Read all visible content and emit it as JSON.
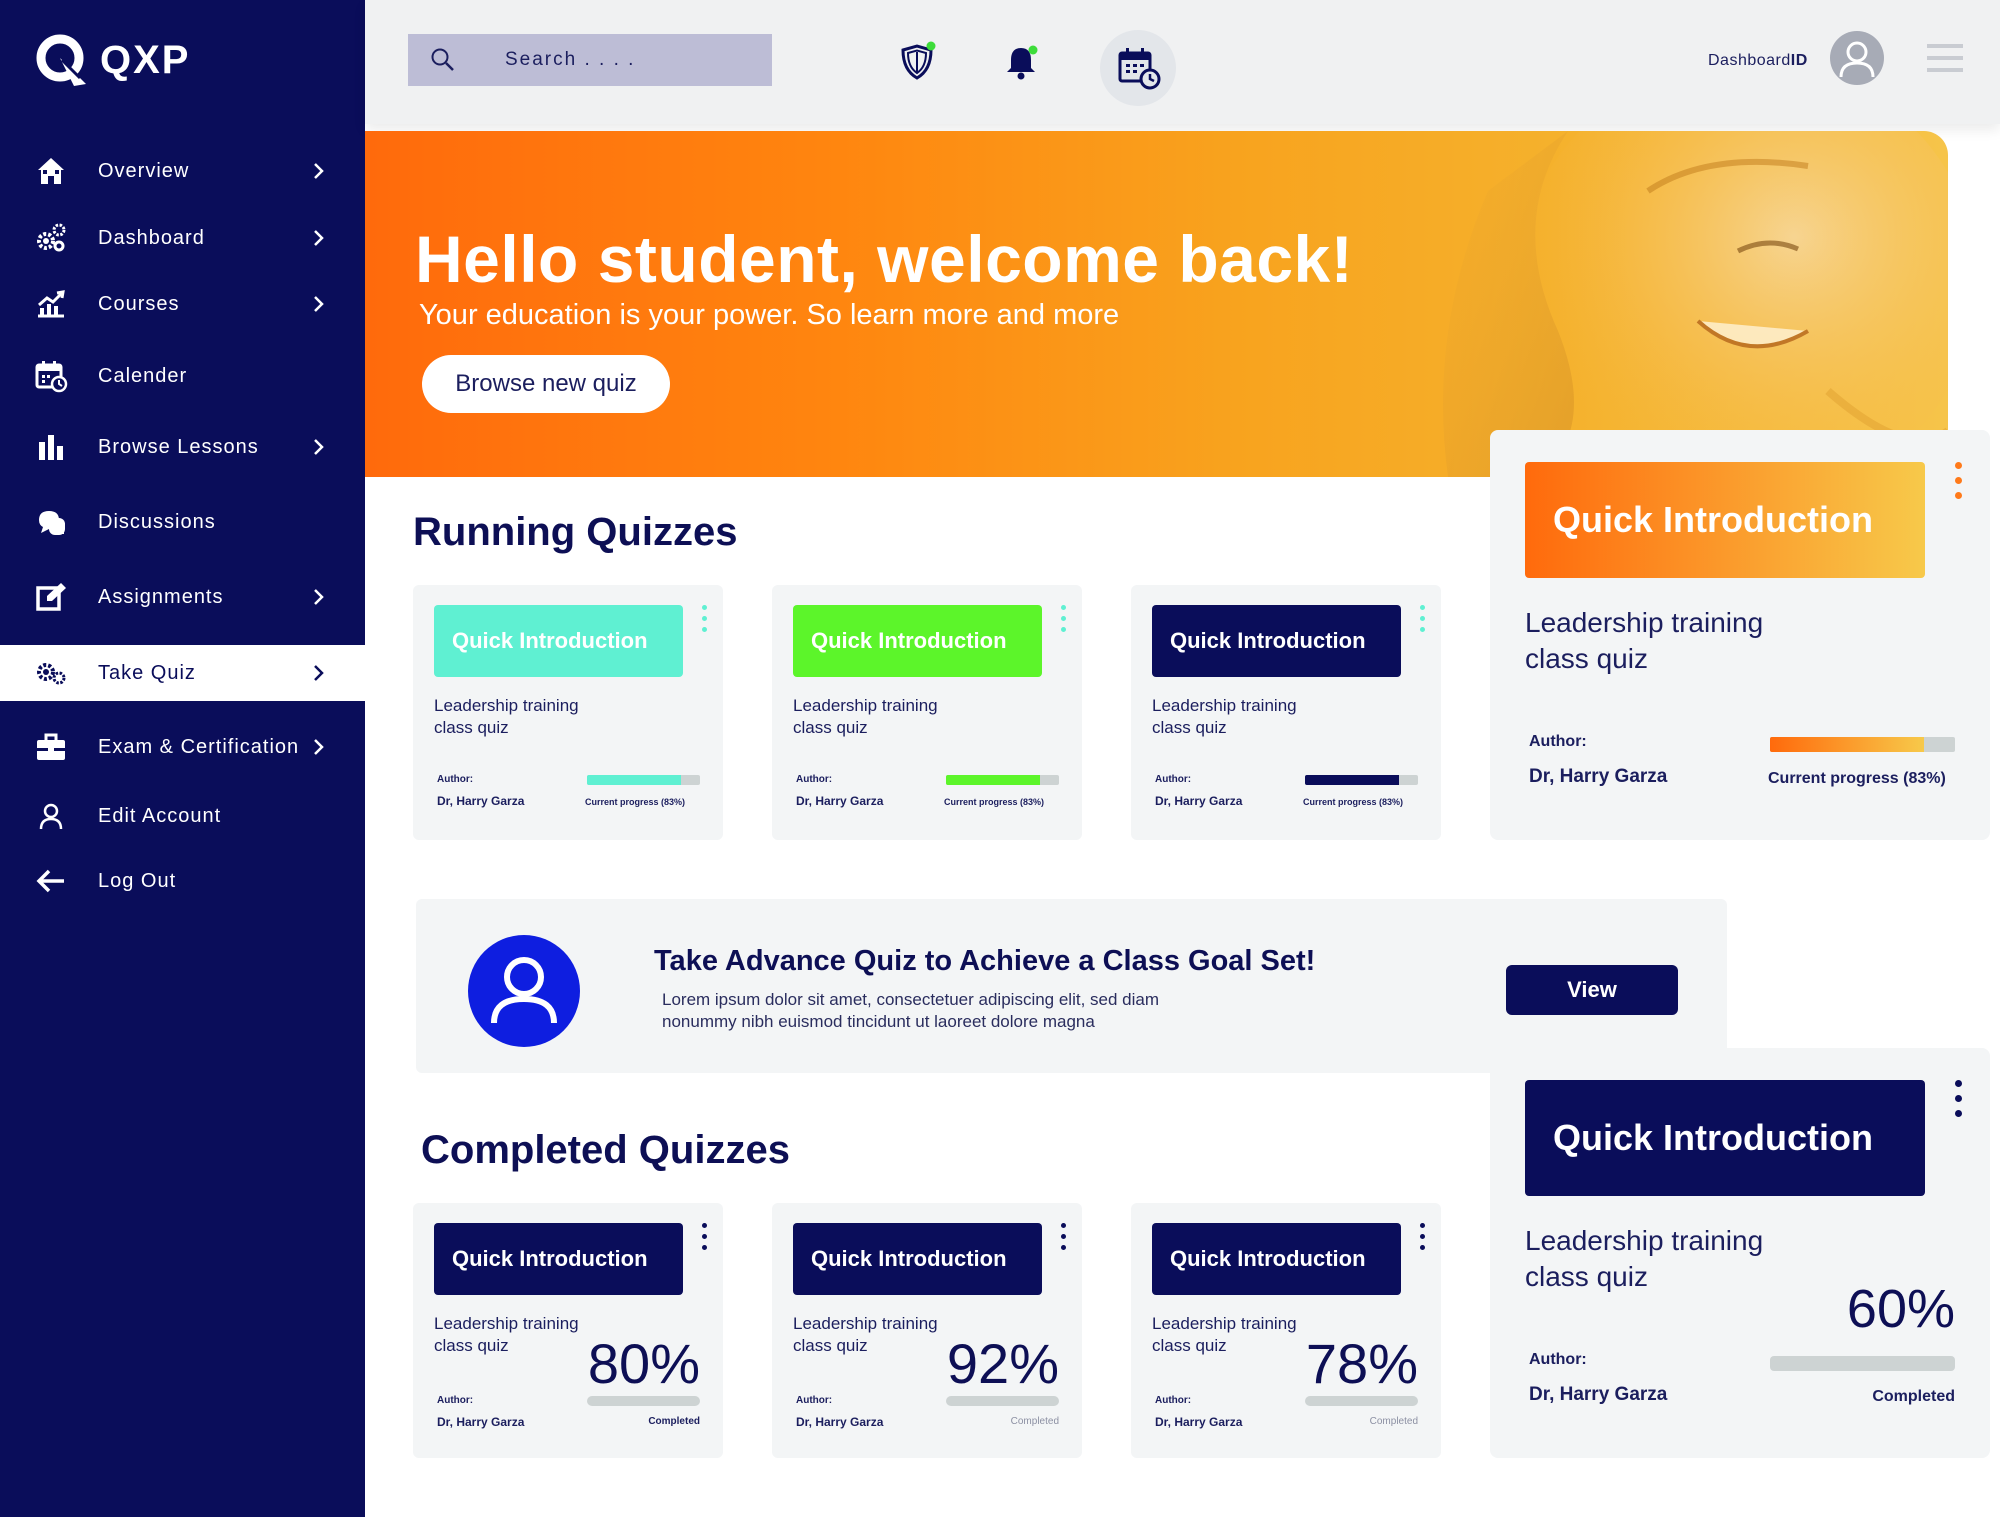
{
  "brand": {
    "name": "QXP"
  },
  "sidebar": {
    "items": [
      {
        "label": "Overview",
        "icon": "home-icon",
        "chevron": true
      },
      {
        "label": "Dashboard",
        "icon": "gears-icon",
        "chevron": true
      },
      {
        "label": "Courses",
        "icon": "chart-icon",
        "chevron": true
      },
      {
        "label": "Calender",
        "icon": "calendar-icon",
        "chevron": false
      },
      {
        "label": "Browse Lessons",
        "icon": "bar-chart-icon",
        "chevron": true
      },
      {
        "label": "Discussions",
        "icon": "chat-icon",
        "chevron": false
      },
      {
        "label": "Assignments",
        "icon": "edit-icon",
        "chevron": true
      },
      {
        "label": "Take Quiz",
        "icon": "gears-icon",
        "chevron": true,
        "active": true
      },
      {
        "label": "Exam & Certification",
        "icon": "briefcase-icon",
        "chevron": true
      },
      {
        "label": "Edit Account",
        "icon": "user-icon",
        "chevron": false
      },
      {
        "label": "Log Out",
        "icon": "arrow-left-icon",
        "chevron": false
      }
    ]
  },
  "topbar": {
    "search_placeholder": "Search . . . .",
    "dashboard_label": "Dashboard",
    "dashboard_id": "ID"
  },
  "banner": {
    "title": "Hello student, welcome back!",
    "subtitle": "Your education is your power. So learn more and more",
    "button_label": "Browse new quiz"
  },
  "running": {
    "title": "Running Quizzes",
    "cards": [
      {
        "title": "Quick Introduction",
        "desc": "Leadership training class quiz",
        "author_label": "Author:",
        "author": "Dr, Harry Garza",
        "progress": 83,
        "progress_label": "Current progress (83%)",
        "color": "#5ff0d2",
        "dot": "#5ff0d2"
      },
      {
        "title": "Quick Introduction",
        "desc": "Leadership training class quiz",
        "author_label": "Author:",
        "author": "Dr, Harry Garza",
        "progress": 83,
        "progress_label": "Current progress (83%)",
        "color": "#5cf52a",
        "dot": "#5cf52a"
      },
      {
        "title": "Quick Introduction",
        "desc": "Leadership training class quiz",
        "author_label": "Author:",
        "author": "Dr, Harry Garza",
        "progress": 83,
        "progress_label": "Current progress (83%)",
        "color": "#0a0d5a",
        "dot": "#5ff0d2"
      }
    ],
    "feature": {
      "title": "Quick Introduction",
      "desc": "Leadership training class quiz",
      "author_label": "Author:",
      "author": "Dr, Harry Garza",
      "progress": 83,
      "progress_label": "Current progress (83%)"
    }
  },
  "promo": {
    "title": "Take Advance Quiz to Achieve a Class Goal Set!",
    "text": "Lorem ipsum dolor sit amet, consectetuer adipiscing elit, sed diam nonummy nibh euismod tincidunt ut laoreet dolore magna",
    "button_label": "View"
  },
  "completed": {
    "title": "Completed Quizzes",
    "cards": [
      {
        "title": "Quick Introduction",
        "desc": "Leadership training class quiz",
        "author_label": "Author:",
        "author": "Dr, Harry Garza",
        "percent": "80%",
        "status": "Completed"
      },
      {
        "title": "Quick Introduction",
        "desc": "Leadership training class quiz",
        "author_label": "Author:",
        "author": "Dr, Harry Garza",
        "percent": "92%",
        "status": "Completed"
      },
      {
        "title": "Quick Introduction",
        "desc": "Leadership training class quiz",
        "author_label": "Author:",
        "author": "Dr, Harry Garza",
        "percent": "78%",
        "status": "Completed"
      }
    ],
    "feature": {
      "title": "Quick Introduction",
      "desc": "Leadership training class quiz",
      "author_label": "Author:",
      "author": "Dr, Harry Garza",
      "percent": "60%",
      "status": "Completed"
    }
  },
  "colors": {
    "navy": "#0a0d5a",
    "orange": "#ff6a0c",
    "mint": "#5ff0d2",
    "lime": "#5cf52a",
    "status_green": "#3ddc3a"
  }
}
